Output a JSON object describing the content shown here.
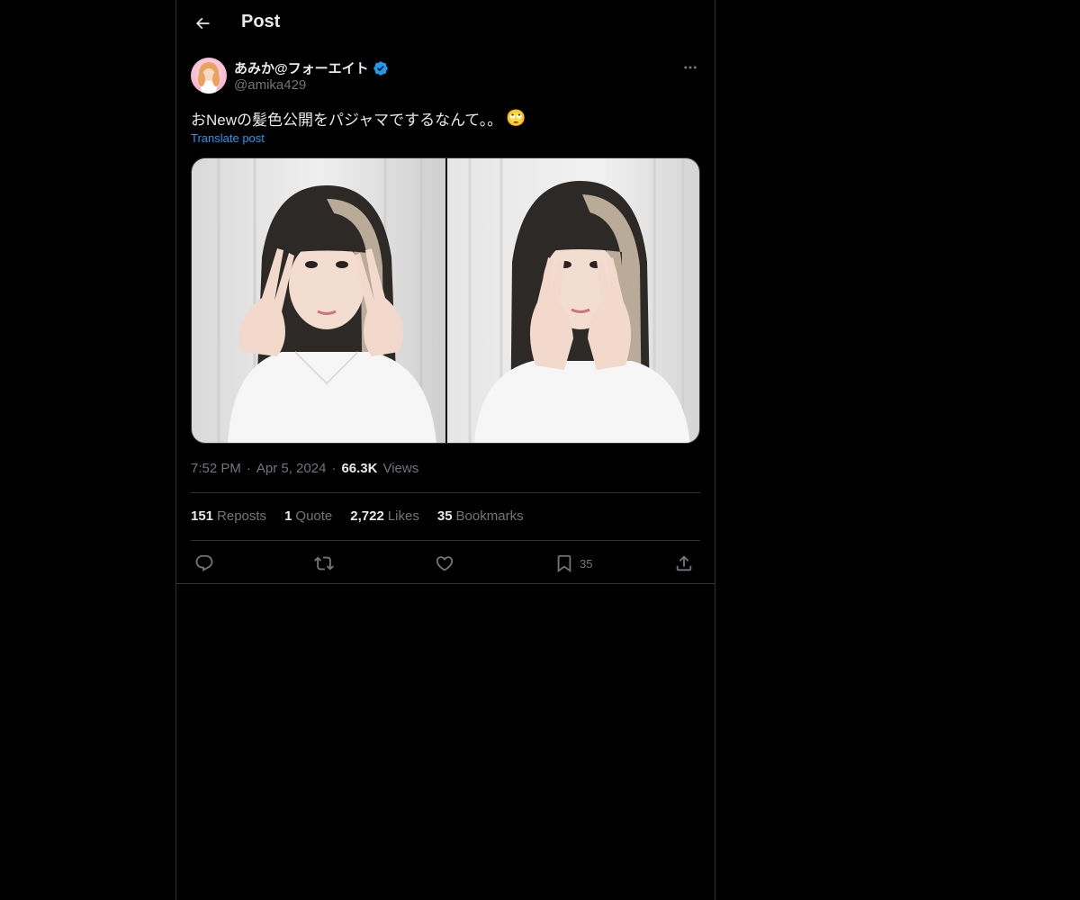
{
  "header": {
    "back_icon": "arrow-left-icon",
    "title": "Post"
  },
  "author": {
    "display_name": "あみか@フォーエイト",
    "verified_icon": "verified-badge-icon",
    "handle": "@amika429",
    "more_icon": "more-horizontal-icon"
  },
  "post": {
    "text": "おNewの髪色公開をパジャマでするなんて。。",
    "emoji": "🙄",
    "translate_label": "Translate post",
    "photos": [
      "peace-sign-photo",
      "hands-on-cheeks-photo"
    ]
  },
  "meta": {
    "time": "7:52 PM",
    "date": "Apr 5, 2024",
    "views_count": "66.3K",
    "views_label": "Views",
    "separator": "·"
  },
  "stats": {
    "reposts_count": "151",
    "reposts_label": "Reposts",
    "quotes_count": "1",
    "quotes_label": "Quote",
    "likes_count": "2,722",
    "likes_label": "Likes",
    "bookmarks_count": "35",
    "bookmarks_label": "Bookmarks"
  },
  "actions": {
    "reply_icon": "reply-icon",
    "repost_icon": "repost-icon",
    "like_icon": "heart-icon",
    "bookmark_icon": "bookmark-icon",
    "bookmark_count": "35",
    "share_icon": "share-icon"
  },
  "colors": {
    "background": "#000000",
    "text_primary": "#e7e9ea",
    "text_secondary": "#71767b",
    "accent": "#1d9bf0",
    "border": "#2f3336"
  }
}
